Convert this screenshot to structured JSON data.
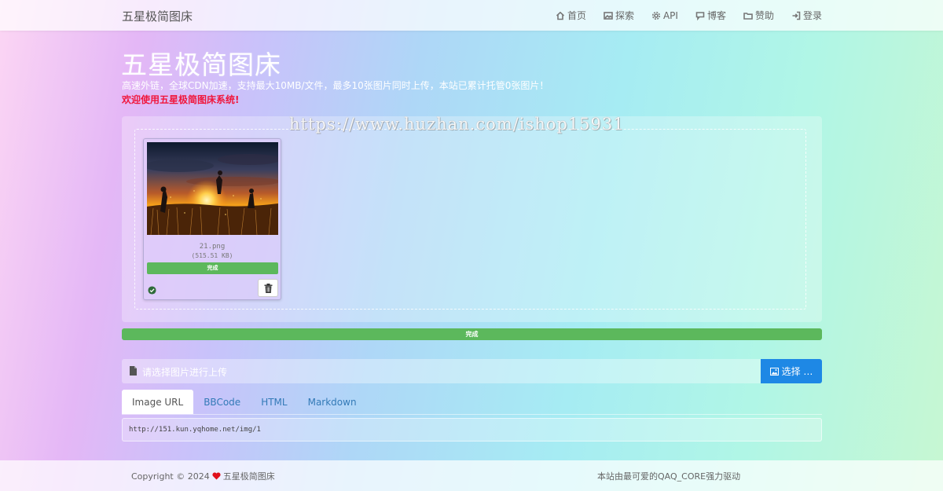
{
  "navbar": {
    "brand": "五星极简图床",
    "links": [
      {
        "label": "首页",
        "icon": "home-icon"
      },
      {
        "label": "探索",
        "icon": "image-icon"
      },
      {
        "label": "API",
        "icon": "gear-icon"
      },
      {
        "label": "博客",
        "icon": "comment-icon"
      },
      {
        "label": "赞助",
        "icon": "folder-icon"
      },
      {
        "label": "登录",
        "icon": "login-icon"
      }
    ]
  },
  "header": {
    "title": "五星极简图床",
    "description": "高速外链，全球CDN加速，支持最大10MB/文件，最多10张图片同时上传，本站已累计托管0张图片！",
    "welcome": "欢迎使用五星极简图床系统!"
  },
  "watermark": "https://www.huzhan.com/ishop15931",
  "file_card": {
    "name": "21.png",
    "size": "(515.51 KB)",
    "status": "完成",
    "progress": 1.0,
    "check_icon": "check-circle-icon",
    "delete_icon": "trash-icon"
  },
  "main_progress": {
    "label": "完成",
    "progress": 1.0
  },
  "file_input": {
    "caption": "请选择图片进行上传",
    "browse_label": "选择 …"
  },
  "tabs": [
    {
      "label": "Image URL",
      "active": true
    },
    {
      "label": "BBCode",
      "active": false
    },
    {
      "label": "HTML",
      "active": false
    },
    {
      "label": "Markdown",
      "active": false
    }
  ],
  "url_output": "http://151.kun.yqhome.net/img/1",
  "footer": {
    "copyright_prefix": "Copyright © 2024",
    "copyright_name": "五星极简图床",
    "powered": "本站由最可爱的QAQ_CORE强力驱动"
  },
  "colors": {
    "accent": "#1e88e5",
    "success": "#5cb85c",
    "welcome": "#f0163c",
    "heart": "#e0101c"
  }
}
